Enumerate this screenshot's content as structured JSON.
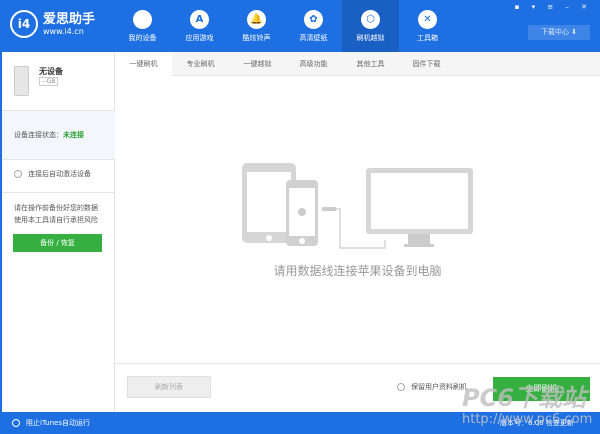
{
  "header": {
    "logo_mark": "i4",
    "logo_name": "爱思助手",
    "logo_url": "www.i4.cn",
    "download_center": "下载中心 ⬇",
    "window_controls": "▪ ▾ ≡ – ✕",
    "nav": [
      {
        "label": "我的设备",
        "icon": ""
      },
      {
        "label": "应用游戏",
        "icon": "A"
      },
      {
        "label": "酷炫铃声",
        "icon": "🔔"
      },
      {
        "label": "高清壁纸",
        "icon": "✿"
      },
      {
        "label": "刷机越狱",
        "icon": "⬡"
      },
      {
        "label": "工具箱",
        "icon": "✕"
      }
    ],
    "active_nav": 4
  },
  "sidebar": {
    "device_name": "无设备",
    "capacity": "--GB",
    "status_label": "设备连接状态：",
    "status_value": "未连接",
    "status_color": "#2ea23b",
    "auto_activate": "连接后自动激活设备",
    "warning_line1": "请在操作前备份好您的数据",
    "warning_line2": "使用本工具请自行承担风险",
    "backup_button": "备份 / 恢复"
  },
  "tabs": [
    "一键刷机",
    "专业刷机",
    "一键越狱",
    "高级功能",
    "其他工具",
    "固件下载"
  ],
  "main": {
    "message": "请用数据线连接苹果设备到电脑",
    "refresh_button": "刷新列表",
    "keep_data": "保留用户资料刷机",
    "flash_button": "立即刷机"
  },
  "statusbar": {
    "block_itunes": "阻止iTunes自动运行",
    "version": "版本号：6.08",
    "check_update": "检查更新"
  },
  "watermark": {
    "title": "PC6下载站",
    "url": "http://www.pc6.com"
  },
  "colors": {
    "brand": "#1d6fe2",
    "green": "#35b040"
  }
}
